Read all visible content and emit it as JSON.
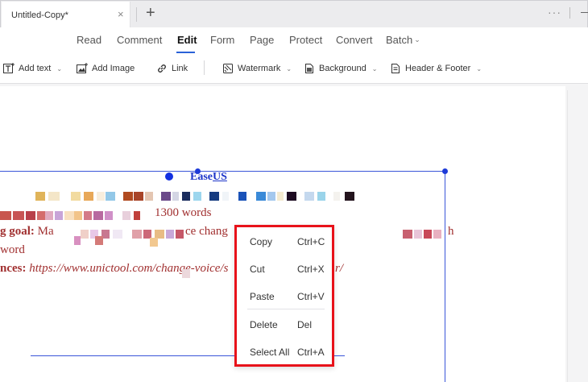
{
  "tab": {
    "title": "Untitled-Copy*",
    "close_glyph": "×",
    "add_glyph": "+"
  },
  "window": {
    "more_glyph": "···"
  },
  "menu": {
    "items": [
      "Read",
      "Comment",
      "Edit",
      "Form",
      "Page",
      "Protect",
      "Convert",
      "Batch"
    ],
    "active": "Edit",
    "caret": "⌄"
  },
  "toolbar": {
    "items": [
      {
        "label": "Add text",
        "icon": "add-text-icon",
        "caret": "⌄"
      },
      {
        "label": "Add Image",
        "icon": "add-image-icon"
      },
      {
        "label": "Link",
        "icon": "link-icon"
      },
      {
        "label": "Watermark",
        "icon": "watermark-icon",
        "caret": "⌄"
      },
      {
        "label": "Background",
        "icon": "background-icon",
        "caret": "⌄"
      },
      {
        "label": "Header & Footer",
        "icon": "header-footer-icon",
        "caret": "⌄"
      }
    ]
  },
  "document": {
    "title_prefix": "Ease",
    "title_highlight": "US",
    "line2_text": "1300 words",
    "line3_bold": "g goal:",
    "line3_text": " Ma",
    "line3_text2": "ce chang",
    "line3_text3": "h",
    "line4_text": "word",
    "line5_bold": "nces:",
    "line5_link": " https://www.unictool.com/change-voice/s",
    "line5_tail": "r/"
  },
  "context_menu": {
    "items": [
      {
        "label": "Copy",
        "shortcut": "Ctrl+C"
      },
      {
        "label": "Cut",
        "shortcut": "Ctrl+X"
      },
      {
        "label": "Paste",
        "shortcut": "Ctrl+V"
      },
      {
        "label": "Delete",
        "shortcut": "Del"
      },
      {
        "label": "Select All",
        "shortcut": "Ctrl+A"
      }
    ]
  },
  "colors": {
    "accent": "#2a62d8",
    "selection": "#3a55d9",
    "highlight_border": "#e8121a",
    "doc_red": "#a13030"
  }
}
